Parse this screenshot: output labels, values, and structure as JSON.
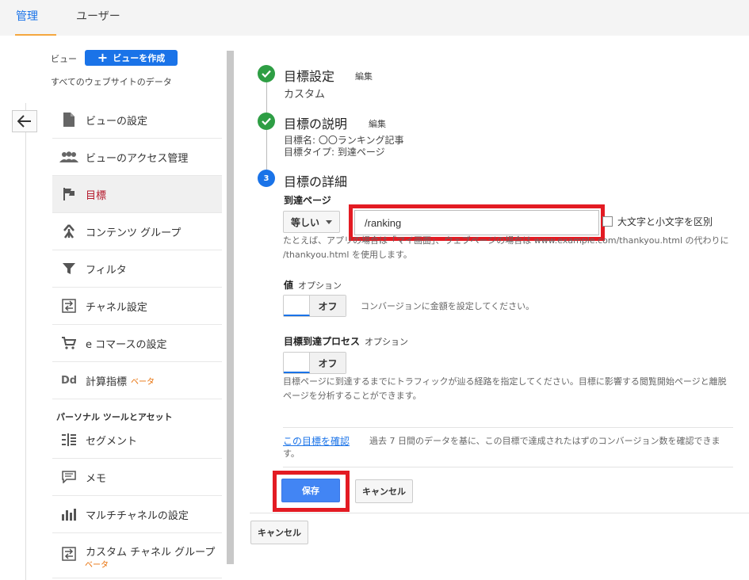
{
  "tabs": [
    {
      "label": "管理",
      "active": true
    },
    {
      "label": "ユーザー",
      "active": false
    }
  ],
  "sidebar": {
    "view_label": "ビュー",
    "create_view_button": "ビューを作成",
    "view_name": "すべてのウェブサイトのデータ",
    "items": [
      {
        "label": "ビューの設定",
        "icon": "document-icon"
      },
      {
        "label": "ビューのアクセス管理",
        "icon": "people-icon"
      },
      {
        "label": "目標",
        "icon": "flag-icon",
        "active": true
      },
      {
        "label": "コンテンツ グループ",
        "icon": "content-grouping-icon"
      },
      {
        "label": "フィルタ",
        "icon": "filter-icon"
      },
      {
        "label": "チャネル設定",
        "icon": "channel-settings-icon"
      },
      {
        "label": "e コマースの設定",
        "icon": "cart-icon"
      },
      {
        "label": "計算指標",
        "icon": "calculated-metrics-icon",
        "badge": "ベータ"
      },
      {
        "label": "セグメント",
        "icon": "segments-icon"
      },
      {
        "label": "メモ",
        "icon": "annotation-icon"
      },
      {
        "label": "マルチチャネルの設定",
        "icon": "bar-chart-icon"
      },
      {
        "label": "カスタム チャネル グループ",
        "icon": "custom-channel-icon",
        "badge": "ベータ"
      }
    ],
    "section_heading": "パーソナル ツールとアセット",
    "calc_icon_text": "Dd"
  },
  "steps": {
    "goal_setup": {
      "title": "目標設定",
      "edit": "編集",
      "value": "カスタム"
    },
    "goal_description": {
      "title": "目標の説明",
      "edit": "編集",
      "name_line": "目標名: 〇〇ランキング記事",
      "type_line": "目標タイプ: 到達ページ"
    },
    "goal_details": {
      "number": "3",
      "title": "目標の詳細"
    }
  },
  "destination": {
    "label": "到達ページ",
    "match_type": "等しい",
    "value": "/ranking",
    "case_sensitive_label": "大文字と小文字を区別",
    "help_line1": "たとえば、アプリの場合は「マイ画面」、ウェブページの場合は www.example.com/thankyou.html の代わりに",
    "help_line2": "/thankyou.html を使用します。"
  },
  "value_field": {
    "label": "値",
    "optional": "オプション",
    "toggle_state": "オフ",
    "help": "コンバージョンに金額を設定してください。"
  },
  "funnel": {
    "label": "目標到達プロセス",
    "optional": "オプション",
    "toggle_state": "オフ",
    "help_line1": "目標ページに到達するまでにトラフィックが辿る経路を指定してください。目標に影響する閲覧開始ページと離脱",
    "help_line2": "ページを分析することができます。"
  },
  "verify": {
    "link": "この目標を確認",
    "description_line1": "過去 7 日間のデータを基に、この目標で達成されたはずのコンバージョン数を確認できま",
    "description_line2": "す。"
  },
  "buttons": {
    "save": "保存",
    "cancel_inner": "キャンセル",
    "cancel_outer": "キャンセル"
  },
  "colors": {
    "accent_blue": "#1a73e8",
    "success_green": "#2e9e44",
    "highlight_red": "#e31b23",
    "active_tab_underline": "#f4a73f"
  }
}
